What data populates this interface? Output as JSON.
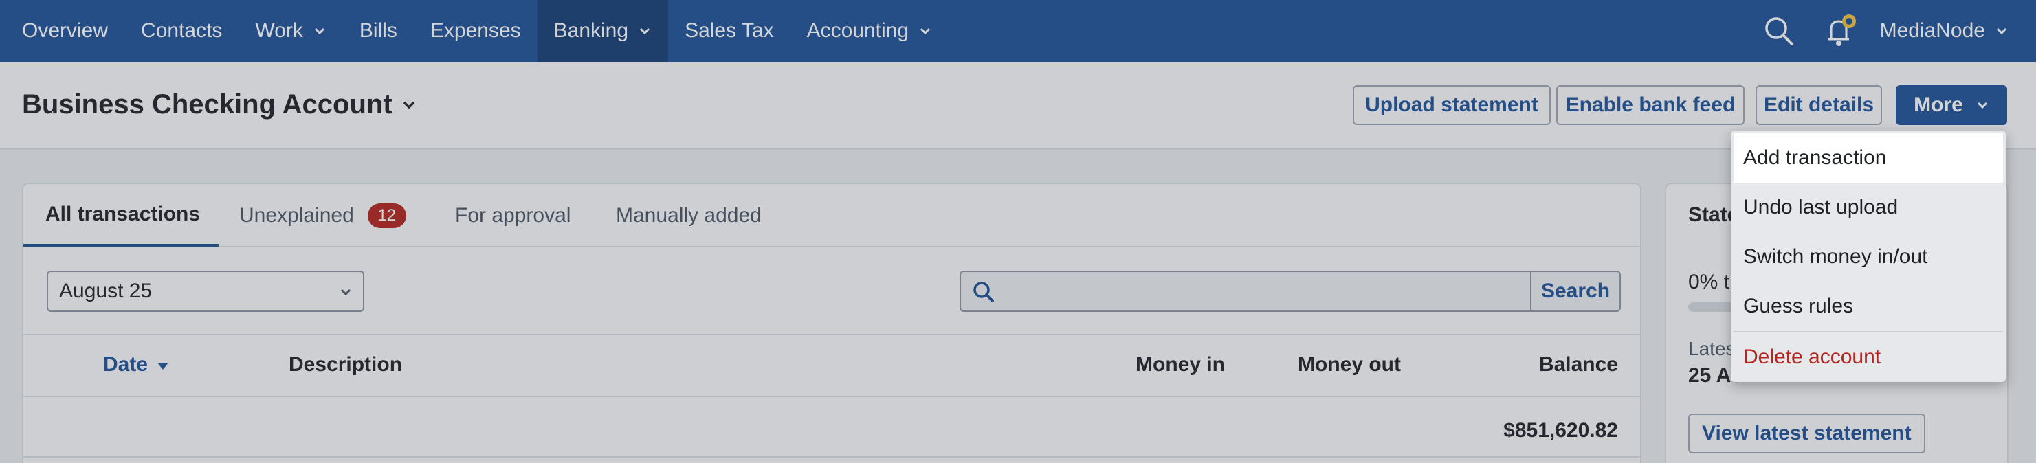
{
  "nav": {
    "items": [
      {
        "label": "Overview",
        "caret": false,
        "active": false
      },
      {
        "label": "Contacts",
        "caret": false,
        "active": false
      },
      {
        "label": "Work",
        "caret": true,
        "active": false
      },
      {
        "label": "Bills",
        "caret": false,
        "active": false
      },
      {
        "label": "Expenses",
        "caret": false,
        "active": false
      },
      {
        "label": "Banking",
        "caret": true,
        "active": true
      },
      {
        "label": "Sales Tax",
        "caret": false,
        "active": false
      },
      {
        "label": "Accounting",
        "caret": true,
        "active": false
      }
    ],
    "user": "MediaNode",
    "icons": [
      "search-icon",
      "bell-icon"
    ]
  },
  "header": {
    "title": "Business Checking Account",
    "buttons": {
      "upload": "Upload statement",
      "bank_feed": "Enable bank feed",
      "edit": "Edit details",
      "more": "More"
    }
  },
  "tabs": {
    "all": "All transactions",
    "unexplained": "Unexplained",
    "unexplained_count": "12",
    "approval": "For approval",
    "manual": "Manually added"
  },
  "filters": {
    "month": "August 25",
    "search_placeholder": "",
    "search_button": "Search"
  },
  "table": {
    "columns": {
      "date": "Date",
      "description": "Description",
      "money_in": "Money in",
      "money_out": "Money out",
      "balance": "Balance"
    },
    "first_row_balance": "$851,620.82"
  },
  "statement_panel": {
    "title": "State",
    "percent": "0% t",
    "progress": 0,
    "latest_label": "Lates",
    "latest_date": "25 Au",
    "button": "View latest statement"
  },
  "more_menu": {
    "items": [
      "Add transaction",
      "Undo last upload",
      "Switch money in/out",
      "Guess rules"
    ],
    "danger_item": "Delete account",
    "highlighted": "Add transaction"
  },
  "colors": {
    "brand": "#1f5398",
    "danger": "#b3261e"
  }
}
